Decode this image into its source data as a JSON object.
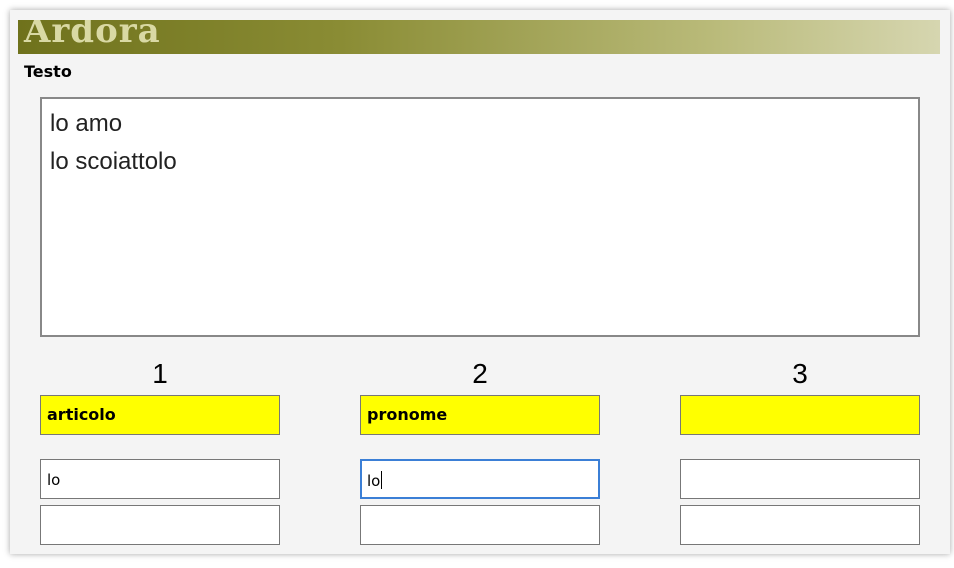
{
  "app": {
    "title": "Ardora"
  },
  "section": {
    "label": "Testo"
  },
  "textarea": {
    "lines": [
      "lo amo",
      "lo scoiattolo"
    ]
  },
  "columns": [
    {
      "number": "1",
      "category": "articolo",
      "fields": [
        "lo",
        ""
      ]
    },
    {
      "number": "2",
      "category": "pronome",
      "fields": [
        "lo",
        ""
      ]
    },
    {
      "number": "3",
      "category": "",
      "fields": [
        "",
        ""
      ]
    }
  ],
  "colors": {
    "category_bg": "#ffff00",
    "active_border": "#3b7fd6",
    "title_gradient_start": "#6f721c"
  }
}
